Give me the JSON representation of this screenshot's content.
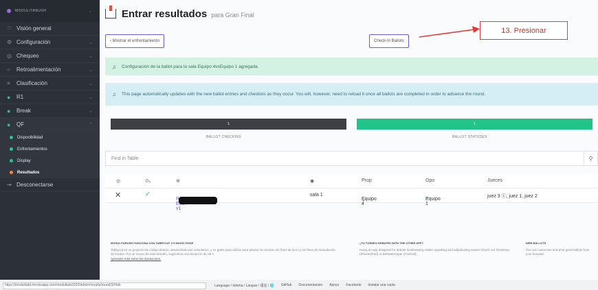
{
  "sidebar": {
    "brand": "MODULITABUSH",
    "items": [
      {
        "icon": "circle-outline-icon",
        "label": "Visión general",
        "chevron": false
      },
      {
        "icon": "gear-icon",
        "label": "Configuración",
        "chevron": true
      },
      {
        "icon": "check-circle-icon",
        "label": "Chequeo",
        "chevron": true
      },
      {
        "icon": "comment-icon",
        "label": "Retroalimentación",
        "chevron": true
      },
      {
        "icon": "list-icon",
        "label": "Clasificación",
        "chevron": true
      },
      {
        "icon": "round-dot-icon",
        "label": "R1",
        "chevron": true
      },
      {
        "icon": "round-dot-icon",
        "label": "Break",
        "chevron": true
      },
      {
        "icon": "round-dot-icon",
        "label": "QF",
        "chevron": true
      }
    ],
    "sub_items": [
      "Disponibilidad",
      "Enfrentamientos",
      "Display",
      "Resultados"
    ],
    "logout": "Desconectarse"
  },
  "header": {
    "title": "Entrar resultados",
    "subtitle": "para Gran Final"
  },
  "buttons": {
    "back": "‹  Mostrar el enfrentamiento",
    "checkin": "Check-In Ballots"
  },
  "alerts": {
    "success": "Configuración de la ballot para la sala Equipo 4vsEquipo 1 agregada.",
    "info": "This page automatically updates with the new ballot entries and checkins as they occur. You will, however, need to reload it once all ballots are completed in order to advance the round."
  },
  "progress": [
    {
      "label": "BALLOT CHECKINS",
      "value_text": "1",
      "color": "#3d3f44"
    },
    {
      "label": "BALLOT STATUSES",
      "value_text": "1",
      "color": "#22c589"
    }
  ],
  "search": {
    "placeholder": "Find in Table"
  },
  "table": {
    "headers": [
      "Sala",
      "Estado",
      "Edición",
      "Lugar",
      "Prop",
      "Opo",
      "Jueces"
    ],
    "header_icons": [
      "target-icon",
      "check-out-icon",
      "edit-circle-icon",
      "pin-icon"
    ],
    "row": {
      "status": "✕",
      "checkin": "✓",
      "edit": "Re-Edit v1",
      "sala": "sala 1",
      "prop": "Equipo 4",
      "opo": "Equipo 1",
      "jueces": "juez 3 ⓒ, juez 1, juez 2"
    }
  },
  "table_header_visible": {
    "prop": "Prop",
    "opo": "Opo",
    "jueces": "Jueces"
  },
  "footer": {
    "col1_title": "MODULITABUSH FUNCIONA CON TABBYCAT 2.5 MAGIC ROSE",
    "col1_text": "Tabbycat es un proyecto de código abierto, desarrollado por voluntarios, y es gratis para utilizar para tabular los torneos sin fines de lucro y sin fines de recaudación de fondos. Por un torneo de este tamaño, sugerimos una donación de A$ 4.",
    "col1_link": "Aprender más sobre las donaciones.",
    "col2_title": "¿TU TORNEO DEBATES WITH THE OTHER APP?",
    "col2_text": "Using an app designed for debate timekeeping makes speaking and adjudicating easier! Check out Timekeep (iPhone/iPad) or DebateKeeper (Android).",
    "col3_title": "WEB BALLOTS",
    "col3_text": "You can customise and print great ballots from your browser."
  },
  "bottom": {
    "url": "https://modulitabt.herokuapp.com/modulitab2020/admin/results/round/3/#tab",
    "links": [
      "Language / Idioma / Langue / 语言 / 🌐",
      "GitHub",
      "Documentación",
      "Apoyo",
      "Facebook",
      "Instalar una copia"
    ]
  },
  "annotation": {
    "text": "13. Presionar"
  }
}
